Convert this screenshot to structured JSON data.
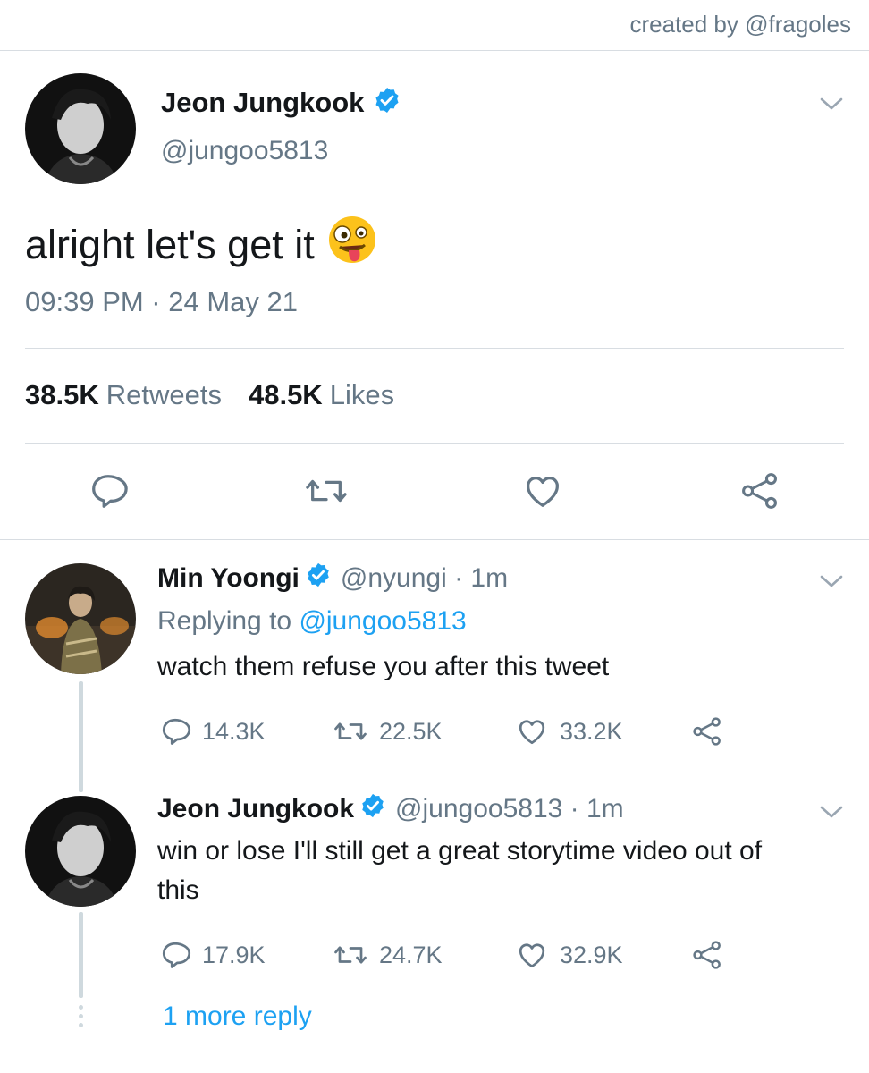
{
  "credit": "created by @fragoles",
  "main_tweet": {
    "name": "Jeon Jungkook",
    "handle": "@jungoo5813",
    "text": "alright let's get it",
    "emoji": "zany-face-emoji",
    "timestamp": "09:39 PM · 24 May 21",
    "retweets_count": "38.5K",
    "retweets_label": "Retweets",
    "likes_count": "48.5K",
    "likes_label": "Likes"
  },
  "replies": [
    {
      "name": "Min Yoongi",
      "handle": "@nyungi · 1m",
      "replying_prefix": "Replying to",
      "replying_to": "@jungoo5813",
      "text": "watch them refuse you after this tweet",
      "replies": "14.3K",
      "retweets": "22.5K",
      "likes": "33.2K"
    },
    {
      "name": "Jeon Jungkook",
      "handle": "@jungoo5813 · 1m",
      "text": "win or lose I'll still get a great storytime video out of this",
      "replies": "17.9K",
      "retweets": "24.7K",
      "likes": "32.9K"
    }
  ],
  "more_reply": "1 more reply",
  "colors": {
    "accent": "#1da1f2",
    "muted": "#657786",
    "text": "#14171a",
    "divider": "#d8dde2"
  }
}
